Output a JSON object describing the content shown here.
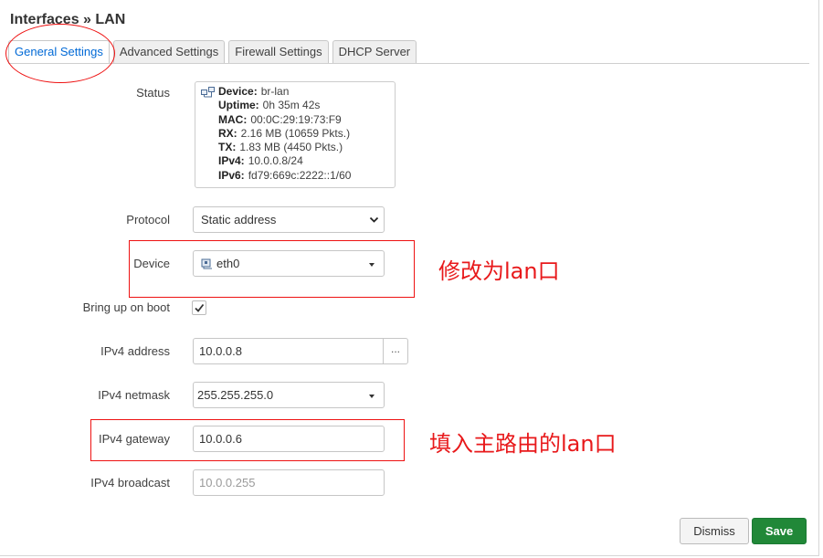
{
  "header": {
    "title": "Interfaces » LAN"
  },
  "tabs": [
    {
      "label": "General Settings",
      "active": true
    },
    {
      "label": "Advanced Settings",
      "active": false
    },
    {
      "label": "Firewall Settings",
      "active": false
    },
    {
      "label": "DHCP Server",
      "active": false
    }
  ],
  "status": {
    "label": "Status",
    "device_key": "Device:",
    "device_val": "br-lan",
    "uptime_key": "Uptime:",
    "uptime_val": "0h 35m 42s",
    "mac_key": "MAC:",
    "mac_val": "00:0C:29:19:73:F9",
    "rx_key": "RX:",
    "rx_val": "2.16 MB (10659 Pkts.)",
    "tx_key": "TX:",
    "tx_val": "1.83 MB (4450 Pkts.)",
    "ipv4_key": "IPv4:",
    "ipv4_val": "10.0.0.8/24",
    "ipv6_key": "IPv6:",
    "ipv6_val": "fd79:669c:2222::1/60"
  },
  "form": {
    "protocol": {
      "label": "Protocol",
      "value": "Static address"
    },
    "device": {
      "label": "Device",
      "value": "eth0"
    },
    "bring_up": {
      "label": "Bring up on boot",
      "checked": true
    },
    "ipv4_address": {
      "label": "IPv4 address",
      "value": "10.0.0.8",
      "button": "..."
    },
    "ipv4_netmask": {
      "label": "IPv4 netmask",
      "value": "255.255.255.0"
    },
    "ipv4_gateway": {
      "label": "IPv4 gateway",
      "value": "10.0.0.6"
    },
    "ipv4_broadcast": {
      "label": "IPv4 broadcast",
      "placeholder": "10.0.0.255"
    }
  },
  "footer": {
    "dismiss": "Dismiss",
    "save": "Save"
  },
  "annotations": {
    "device_note": "修改为lan口",
    "gateway_note": "填入主路由的lan口",
    "color": "#e8191b"
  },
  "colors": {
    "accent": "#0069d6",
    "save": "#218838"
  }
}
